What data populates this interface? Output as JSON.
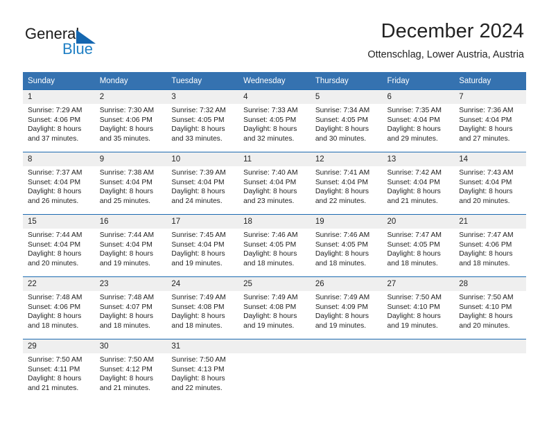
{
  "brand": {
    "name_part1": "General",
    "name_part2": "Blue",
    "triangle_color": "#1567b0",
    "blue_color": "#1f7fc4"
  },
  "header": {
    "title": "December 2024",
    "subtitle": "Ottenschlag, Lower Austria, Austria"
  },
  "theme": {
    "header_row_bg": "#3572b0",
    "daynum_bg": "#efefef",
    "row_divider": "#1a69b0"
  },
  "calendar": {
    "weekday_headers": [
      "Sunday",
      "Monday",
      "Tuesday",
      "Wednesday",
      "Thursday",
      "Friday",
      "Saturday"
    ],
    "weeks": [
      [
        {
          "day": "1",
          "sunrise": "Sunrise: 7:29 AM",
          "sunset": "Sunset: 4:06 PM",
          "daylight_line1": "Daylight: 8 hours",
          "daylight_line2": "and 37 minutes."
        },
        {
          "day": "2",
          "sunrise": "Sunrise: 7:30 AM",
          "sunset": "Sunset: 4:06 PM",
          "daylight_line1": "Daylight: 8 hours",
          "daylight_line2": "and 35 minutes."
        },
        {
          "day": "3",
          "sunrise": "Sunrise: 7:32 AM",
          "sunset": "Sunset: 4:05 PM",
          "daylight_line1": "Daylight: 8 hours",
          "daylight_line2": "and 33 minutes."
        },
        {
          "day": "4",
          "sunrise": "Sunrise: 7:33 AM",
          "sunset": "Sunset: 4:05 PM",
          "daylight_line1": "Daylight: 8 hours",
          "daylight_line2": "and 32 minutes."
        },
        {
          "day": "5",
          "sunrise": "Sunrise: 7:34 AM",
          "sunset": "Sunset: 4:05 PM",
          "daylight_line1": "Daylight: 8 hours",
          "daylight_line2": "and 30 minutes."
        },
        {
          "day": "6",
          "sunrise": "Sunrise: 7:35 AM",
          "sunset": "Sunset: 4:04 PM",
          "daylight_line1": "Daylight: 8 hours",
          "daylight_line2": "and 29 minutes."
        },
        {
          "day": "7",
          "sunrise": "Sunrise: 7:36 AM",
          "sunset": "Sunset: 4:04 PM",
          "daylight_line1": "Daylight: 8 hours",
          "daylight_line2": "and 27 minutes."
        }
      ],
      [
        {
          "day": "8",
          "sunrise": "Sunrise: 7:37 AM",
          "sunset": "Sunset: 4:04 PM",
          "daylight_line1": "Daylight: 8 hours",
          "daylight_line2": "and 26 minutes."
        },
        {
          "day": "9",
          "sunrise": "Sunrise: 7:38 AM",
          "sunset": "Sunset: 4:04 PM",
          "daylight_line1": "Daylight: 8 hours",
          "daylight_line2": "and 25 minutes."
        },
        {
          "day": "10",
          "sunrise": "Sunrise: 7:39 AM",
          "sunset": "Sunset: 4:04 PM",
          "daylight_line1": "Daylight: 8 hours",
          "daylight_line2": "and 24 minutes."
        },
        {
          "day": "11",
          "sunrise": "Sunrise: 7:40 AM",
          "sunset": "Sunset: 4:04 PM",
          "daylight_line1": "Daylight: 8 hours",
          "daylight_line2": "and 23 minutes."
        },
        {
          "day": "12",
          "sunrise": "Sunrise: 7:41 AM",
          "sunset": "Sunset: 4:04 PM",
          "daylight_line1": "Daylight: 8 hours",
          "daylight_line2": "and 22 minutes."
        },
        {
          "day": "13",
          "sunrise": "Sunrise: 7:42 AM",
          "sunset": "Sunset: 4:04 PM",
          "daylight_line1": "Daylight: 8 hours",
          "daylight_line2": "and 21 minutes."
        },
        {
          "day": "14",
          "sunrise": "Sunrise: 7:43 AM",
          "sunset": "Sunset: 4:04 PM",
          "daylight_line1": "Daylight: 8 hours",
          "daylight_line2": "and 20 minutes."
        }
      ],
      [
        {
          "day": "15",
          "sunrise": "Sunrise: 7:44 AM",
          "sunset": "Sunset: 4:04 PM",
          "daylight_line1": "Daylight: 8 hours",
          "daylight_line2": "and 20 minutes."
        },
        {
          "day": "16",
          "sunrise": "Sunrise: 7:44 AM",
          "sunset": "Sunset: 4:04 PM",
          "daylight_line1": "Daylight: 8 hours",
          "daylight_line2": "and 19 minutes."
        },
        {
          "day": "17",
          "sunrise": "Sunrise: 7:45 AM",
          "sunset": "Sunset: 4:04 PM",
          "daylight_line1": "Daylight: 8 hours",
          "daylight_line2": "and 19 minutes."
        },
        {
          "day": "18",
          "sunrise": "Sunrise: 7:46 AM",
          "sunset": "Sunset: 4:05 PM",
          "daylight_line1": "Daylight: 8 hours",
          "daylight_line2": "and 18 minutes."
        },
        {
          "day": "19",
          "sunrise": "Sunrise: 7:46 AM",
          "sunset": "Sunset: 4:05 PM",
          "daylight_line1": "Daylight: 8 hours",
          "daylight_line2": "and 18 minutes."
        },
        {
          "day": "20",
          "sunrise": "Sunrise: 7:47 AM",
          "sunset": "Sunset: 4:05 PM",
          "daylight_line1": "Daylight: 8 hours",
          "daylight_line2": "and 18 minutes."
        },
        {
          "day": "21",
          "sunrise": "Sunrise: 7:47 AM",
          "sunset": "Sunset: 4:06 PM",
          "daylight_line1": "Daylight: 8 hours",
          "daylight_line2": "and 18 minutes."
        }
      ],
      [
        {
          "day": "22",
          "sunrise": "Sunrise: 7:48 AM",
          "sunset": "Sunset: 4:06 PM",
          "daylight_line1": "Daylight: 8 hours",
          "daylight_line2": "and 18 minutes."
        },
        {
          "day": "23",
          "sunrise": "Sunrise: 7:48 AM",
          "sunset": "Sunset: 4:07 PM",
          "daylight_line1": "Daylight: 8 hours",
          "daylight_line2": "and 18 minutes."
        },
        {
          "day": "24",
          "sunrise": "Sunrise: 7:49 AM",
          "sunset": "Sunset: 4:08 PM",
          "daylight_line1": "Daylight: 8 hours",
          "daylight_line2": "and 18 minutes."
        },
        {
          "day": "25",
          "sunrise": "Sunrise: 7:49 AM",
          "sunset": "Sunset: 4:08 PM",
          "daylight_line1": "Daylight: 8 hours",
          "daylight_line2": "and 19 minutes."
        },
        {
          "day": "26",
          "sunrise": "Sunrise: 7:49 AM",
          "sunset": "Sunset: 4:09 PM",
          "daylight_line1": "Daylight: 8 hours",
          "daylight_line2": "and 19 minutes."
        },
        {
          "day": "27",
          "sunrise": "Sunrise: 7:50 AM",
          "sunset": "Sunset: 4:10 PM",
          "daylight_line1": "Daylight: 8 hours",
          "daylight_line2": "and 19 minutes."
        },
        {
          "day": "28",
          "sunrise": "Sunrise: 7:50 AM",
          "sunset": "Sunset: 4:10 PM",
          "daylight_line1": "Daylight: 8 hours",
          "daylight_line2": "and 20 minutes."
        }
      ],
      [
        {
          "day": "29",
          "sunrise": "Sunrise: 7:50 AM",
          "sunset": "Sunset: 4:11 PM",
          "daylight_line1": "Daylight: 8 hours",
          "daylight_line2": "and 21 minutes."
        },
        {
          "day": "30",
          "sunrise": "Sunrise: 7:50 AM",
          "sunset": "Sunset: 4:12 PM",
          "daylight_line1": "Daylight: 8 hours",
          "daylight_line2": "and 21 minutes."
        },
        {
          "day": "31",
          "sunrise": "Sunrise: 7:50 AM",
          "sunset": "Sunset: 4:13 PM",
          "daylight_line1": "Daylight: 8 hours",
          "daylight_line2": "and 22 minutes."
        },
        {
          "day": "",
          "sunrise": "",
          "sunset": "",
          "daylight_line1": "",
          "daylight_line2": ""
        },
        {
          "day": "",
          "sunrise": "",
          "sunset": "",
          "daylight_line1": "",
          "daylight_line2": ""
        },
        {
          "day": "",
          "sunrise": "",
          "sunset": "",
          "daylight_line1": "",
          "daylight_line2": ""
        },
        {
          "day": "",
          "sunrise": "",
          "sunset": "",
          "daylight_line1": "",
          "daylight_line2": ""
        }
      ]
    ]
  }
}
